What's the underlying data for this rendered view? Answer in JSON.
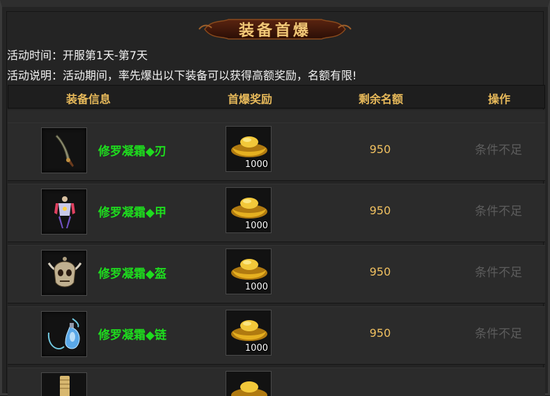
{
  "title": "装备首爆",
  "activity_time": "活动时间：开服第1天-第7天",
  "activity_desc": "活动说明：活动期间，率先爆出以下装备可以获得高额奖励，名额有限!",
  "columns": [
    "装备信息",
    "首爆奖励",
    "剩余名额",
    "操作"
  ],
  "rows": [
    {
      "icon": "blade-icon",
      "name": "修罗凝霜◆刃",
      "reward_icon": "gold-ingot-icon",
      "reward": "1000",
      "remaining": "950",
      "action": "条件不足"
    },
    {
      "icon": "armor-figure-icon",
      "name": "修罗凝霜◆甲",
      "reward_icon": "gold-ingot-icon",
      "reward": "1000",
      "remaining": "950",
      "action": "条件不足"
    },
    {
      "icon": "horned-skull-helmet-icon",
      "name": "修罗凝霜◆盔",
      "reward_icon": "gold-ingot-icon",
      "reward": "1000",
      "remaining": "950",
      "action": "条件不足"
    },
    {
      "icon": "blue-gem-necklace-icon",
      "name": "修罗凝霜◆链",
      "reward_icon": "gold-ingot-icon",
      "reward": "1000",
      "remaining": "950",
      "action": "条件不足"
    }
  ],
  "colors": {
    "item_name": "#1edc1e",
    "header_text": "#e7b95a",
    "remaining_text": "#f0c060",
    "disabled_action": "#5c5c5c"
  }
}
